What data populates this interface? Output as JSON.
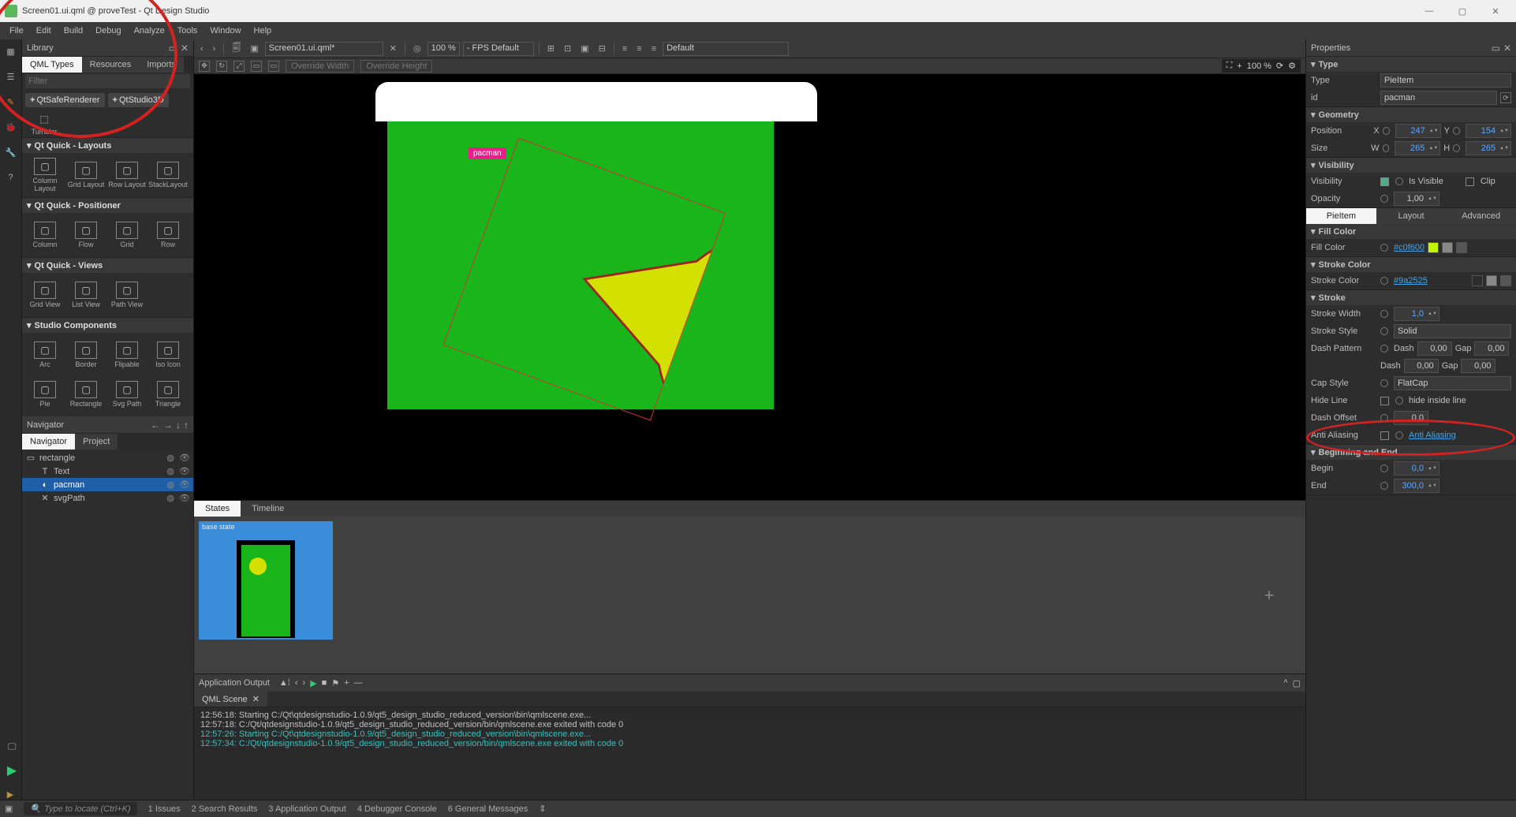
{
  "window": {
    "title": "Screen01.ui.qml @ proveTest - Qt Design Studio"
  },
  "menu": [
    "File",
    "Edit",
    "Build",
    "Debug",
    "Analyze",
    "Tools",
    "Window",
    "Help"
  ],
  "library": {
    "title": "Library",
    "tabs": [
      "QML Types",
      "Resources",
      "Imports"
    ],
    "filter_ph": "Filter",
    "chips": [
      "QtSafeRenderer",
      "QtStudio3D"
    ],
    "tumbler": "Tumbler",
    "sections": [
      {
        "title": "Qt Quick - Layouts",
        "items": [
          "Column Layout",
          "Grid Layout",
          "Row Layout",
          "StackLayout"
        ]
      },
      {
        "title": "Qt Quick - Positioner",
        "items": [
          "Column",
          "Flow",
          "Grid",
          "Row"
        ]
      },
      {
        "title": "Qt Quick - Views",
        "items": [
          "Grid View",
          "List View",
          "Path View"
        ]
      },
      {
        "title": "Studio Components",
        "items": [
          "Arc",
          "Border",
          "Flipable",
          "Iso Icon",
          "Pie",
          "Rectangle",
          "Svg Path",
          "Triangle"
        ]
      }
    ]
  },
  "navigator": {
    "title": "Navigator",
    "tabs": [
      "Navigator",
      "Project"
    ],
    "tree": [
      {
        "name": "rectangle",
        "indent": 0
      },
      {
        "name": "Text",
        "indent": 1,
        "glyph": "T"
      },
      {
        "name": "pacman",
        "indent": 1,
        "sel": true,
        "glyph": "◐"
      },
      {
        "name": "svgPath",
        "indent": 1,
        "glyph": "✕"
      }
    ]
  },
  "editor": {
    "file": "Screen01.ui.qml*",
    "zoom": "100 %",
    "fps": "- FPS  Default",
    "style": "Default",
    "override_w": "Override Width",
    "override_h": "Override Height",
    "pacbadge": "pacman",
    "zoom2": "100 %"
  },
  "states": {
    "tabs": [
      "States",
      "Timeline"
    ],
    "card": "base state"
  },
  "output": {
    "title": "Application Output",
    "tab": "QML Scene",
    "lines": [
      {
        "t": "12:56:18: Starting C:/Qt\\qtdesignstudio-1.0.9/qt5_design_studio_reduced_version\\bin\\qmlscene.exe...",
        "c": ""
      },
      {
        "t": "12:57:18: C:/Qt/qtdesignstudio-1.0.9/qt5_design_studio_reduced_version/bin/qmlscene.exe exited with code 0",
        "c": ""
      },
      {
        "t": "",
        "c": ""
      },
      {
        "t": "12:57:26: Starting C:/Qt\\qtdesignstudio-1.0.9/qt5_design_studio_reduced_version\\bin\\qmlscene.exe...",
        "c": "cyan"
      },
      {
        "t": "12:57:34: C:/Qt/qtdesignstudio-1.0.9/qt5_design_studio_reduced_version/bin/qmlscene.exe exited with code 0",
        "c": "cyan"
      }
    ]
  },
  "properties": {
    "title": "Properties",
    "type": {
      "hdr": "Type",
      "type_lbl": "Type",
      "type_val": "PieItem",
      "id_lbl": "id",
      "id_val": "pacman"
    },
    "geometry": {
      "hdr": "Geometry",
      "pos": "Position",
      "x": "X",
      "xv": "247",
      "y": "Y",
      "yv": "154",
      "size": "Size",
      "w": "W",
      "wv": "265",
      "h": "H",
      "hv": "265"
    },
    "visibility": {
      "hdr": "Visibility",
      "vis": "Visibility",
      "isvis": "Is Visible",
      "clip": "Clip",
      "opacity": "Opacity",
      "ov": "1,00"
    },
    "tabs": [
      "PieItem",
      "Layout",
      "Advanced"
    ],
    "fillcolor": {
      "hdr": "Fill Color",
      "lbl": "Fill Color",
      "val": "#c0f600",
      "sw": "#c0f600"
    },
    "strokecolor": {
      "hdr": "Stroke Color",
      "lbl": "Stroke Color",
      "val": "#9a2525",
      "sw": "#9a2525"
    },
    "stroke": {
      "hdr": "Stroke",
      "width": "Stroke Width",
      "wv": "1,0",
      "style": "Stroke Style",
      "sv": "Solid",
      "dash": "Dash Pattern",
      "d1": "Dash",
      "d1v": "0,00",
      "g1": "Gap",
      "g1v": "0,00",
      "d2": "Dash",
      "d2v": "0,00",
      "g2": "Gap",
      "g2v": "0,00",
      "cap": "Cap Style",
      "capv": "FlatCap",
      "hide": "Hide Line",
      "hidev": "hide inside line",
      "off": "Dash Offset",
      "offv": "0,0",
      "aa": "Anti Aliasing",
      "aav": "Anti Aliasing"
    },
    "begend": {
      "hdr": "Beginning and End",
      "begin": "Begin",
      "bv": "0,0",
      "end": "End",
      "ev": "300,0"
    }
  },
  "status": {
    "locate": "Type to locate (Ctrl+K)",
    "items": [
      "1  Issues",
      "2  Search Results",
      "3  Application Output",
      "4  Debugger Console",
      "6  General Messages"
    ]
  }
}
